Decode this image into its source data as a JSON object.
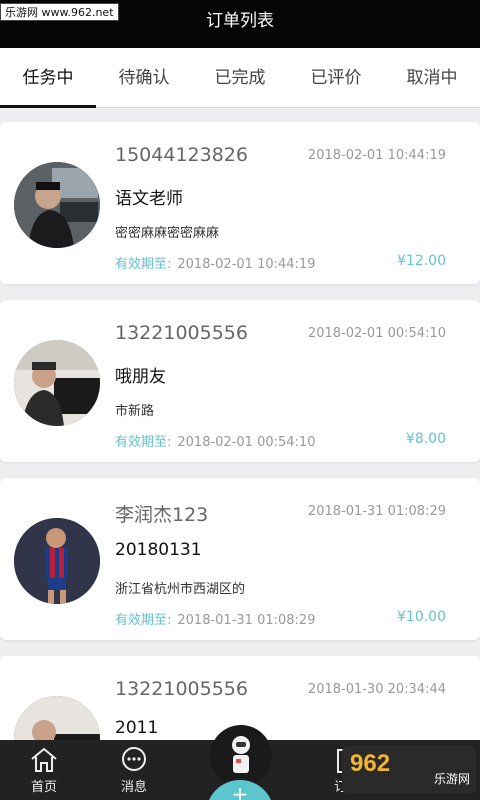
{
  "watermark": "乐游网 www.962.net",
  "header": {
    "title": "订单列表"
  },
  "tabs": [
    {
      "label": "任务中",
      "active": true
    },
    {
      "label": "待确认",
      "active": false
    },
    {
      "label": "已完成",
      "active": false
    },
    {
      "label": "已评价",
      "active": false
    },
    {
      "label": "取消中",
      "active": false
    }
  ],
  "valid_label": "有效期至:",
  "orders": [
    {
      "phone": "15044123826",
      "time": "2018-02-01 10:44:19",
      "name": "语文老师",
      "address": "密密麻麻密密麻麻",
      "valid_until": "2018-02-01 10:44:19",
      "price": "¥12.00"
    },
    {
      "phone": "13221005556",
      "time": "2018-02-01 00:54:10",
      "name": "哦朋友",
      "address": "市新路",
      "valid_until": "2018-02-01 00:54:10",
      "price": "¥8.00"
    },
    {
      "phone": "李润杰123",
      "time": "2018-01-31 01:08:29",
      "name": "20180131",
      "address": "浙江省杭州市西湖区的",
      "valid_until": "2018-01-31 01:08:29",
      "price": "¥10.00"
    },
    {
      "phone": "13221005556",
      "time": "2018-01-30 20:34:44",
      "name": "2011",
      "address": "",
      "valid_until": "",
      "price": ""
    }
  ],
  "bottom_nav": {
    "home": "首页",
    "messages": "消息",
    "orders": "订单",
    "plus": "+"
  },
  "logo": {
    "big": "962",
    "sub": "乐游网"
  },
  "colors": {
    "accent": "#5cc6cf",
    "header_bg": "#050505",
    "nav_bg": "#222222"
  }
}
